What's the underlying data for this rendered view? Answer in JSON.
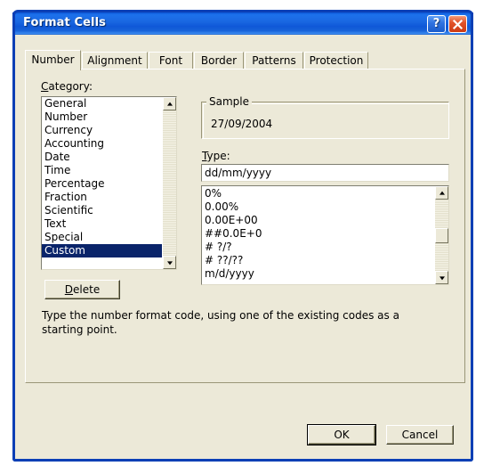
{
  "window": {
    "title": "Format Cells",
    "help_button": "?",
    "close_button": "✕",
    "accent_color": "#0b3fb5",
    "face_color": "#ece9d8",
    "selection_color": "#0a246a"
  },
  "tabs": [
    {
      "label": "Number",
      "selected": true
    },
    {
      "label": "Alignment",
      "selected": false
    },
    {
      "label": "Font",
      "selected": false
    },
    {
      "label": "Border",
      "selected": false
    },
    {
      "label": "Patterns",
      "selected": false
    },
    {
      "label": "Protection",
      "selected": false
    }
  ],
  "category": {
    "label_prefix": "C",
    "label_rest": "ategory:",
    "items": [
      {
        "label": "General",
        "selected": false
      },
      {
        "label": "Number",
        "selected": false
      },
      {
        "label": "Currency",
        "selected": false
      },
      {
        "label": "Accounting",
        "selected": false
      },
      {
        "label": "Date",
        "selected": false
      },
      {
        "label": "Time",
        "selected": false
      },
      {
        "label": "Percentage",
        "selected": false
      },
      {
        "label": "Fraction",
        "selected": false
      },
      {
        "label": "Scientific",
        "selected": false
      },
      {
        "label": "Text",
        "selected": false
      },
      {
        "label": "Special",
        "selected": false
      },
      {
        "label": "Custom",
        "selected": true
      }
    ]
  },
  "delete_button": {
    "prefix": "D",
    "rest": "elete"
  },
  "description": "Type the number format code, using one of the existing codes as a starting point.",
  "sample": {
    "legend": "Sample",
    "value": "27/09/2004"
  },
  "type": {
    "label_prefix": "T",
    "label_rest": "ype:",
    "input_value": "dd/mm/yyyy",
    "items": [
      "0%",
      "0.00%",
      "0.00E+00",
      "##0.0E+0",
      "# ?/?",
      "# ??/??",
      "m/d/yyyy"
    ]
  },
  "buttons": {
    "ok": "OK",
    "cancel": "Cancel"
  }
}
